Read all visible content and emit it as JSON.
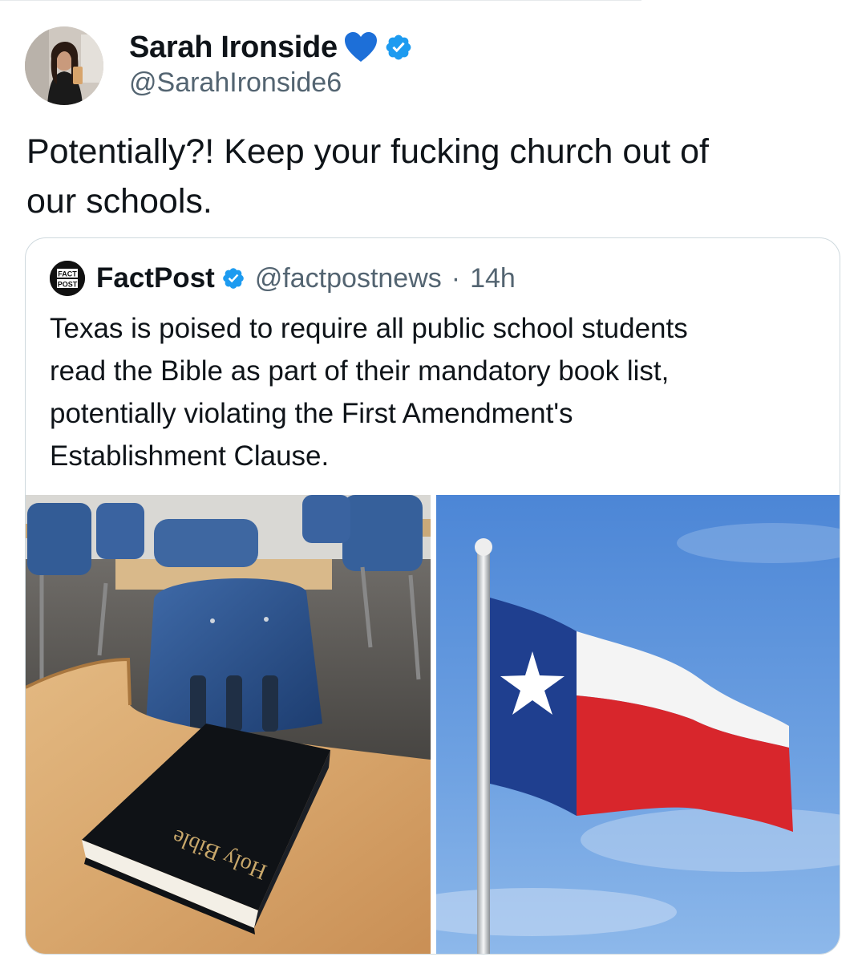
{
  "author": {
    "display_name": "Sarah Ironside",
    "handle": "@SarahIronside6",
    "heart_emoji": "blue-heart-icon",
    "verified_color": "#1d9bf0"
  },
  "tweet": {
    "line1": "Potentially?! Keep your fucking church out of",
    "line2": "our schools."
  },
  "quote": {
    "logo_text_top": "FACT",
    "logo_text_bottom": "POST",
    "name": "FactPost",
    "handle": "@factpostnews",
    "separator": "·",
    "time": "14h",
    "text_lines": [
      "Texas is poised to require all public school students",
      "read the Bible as part of their mandatory book list,",
      "potentially violating the First Amendment's",
      "Establishment Clause."
    ]
  },
  "media": {
    "left_book_label": "Holy Bible",
    "left_description_icon": "classroom-bible-image",
    "right_description_icon": "texas-flag-image"
  }
}
